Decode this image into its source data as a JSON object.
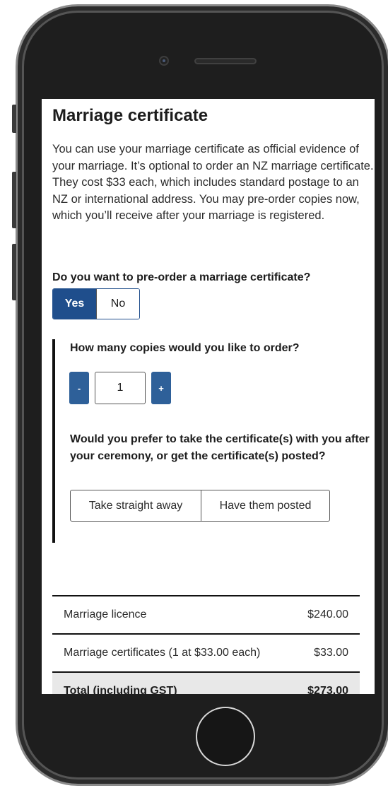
{
  "page": {
    "title": "Marriage certificate",
    "intro": "You can use your marriage certificate as official evidence of your marriage. It’s optional to order an NZ marriage certificate. They cost $33 each, which includes standard postage to an NZ or international address. You may pre-order copies now, which you’ll receive after your marriage is registered."
  },
  "preorder": {
    "question": "Do you want to pre-order a marriage certificate?",
    "yes_label": "Yes",
    "no_label": "No",
    "selected": "Yes"
  },
  "copies": {
    "question": "How many copies would you like to order?",
    "minus_label": "-",
    "plus_label": "+",
    "value": "1"
  },
  "delivery": {
    "question": "Would you prefer to take the certificate(s) with you after your ceremony, or get the certificate(s) posted?",
    "option_take": "Take straight away",
    "option_post": "Have them posted"
  },
  "summary": {
    "rows": [
      {
        "label": "Marriage licence",
        "amount": "$240.00"
      },
      {
        "label": "Marriage certificates (1 at $33.00 each)",
        "amount": "$33.00"
      }
    ],
    "total_label": "Total (including GST)",
    "total_amount": "$273.00"
  },
  "colors": {
    "accent": "#1f4e8c",
    "stepper": "#2e6099",
    "total_row_bg": "#e8e8e8"
  }
}
